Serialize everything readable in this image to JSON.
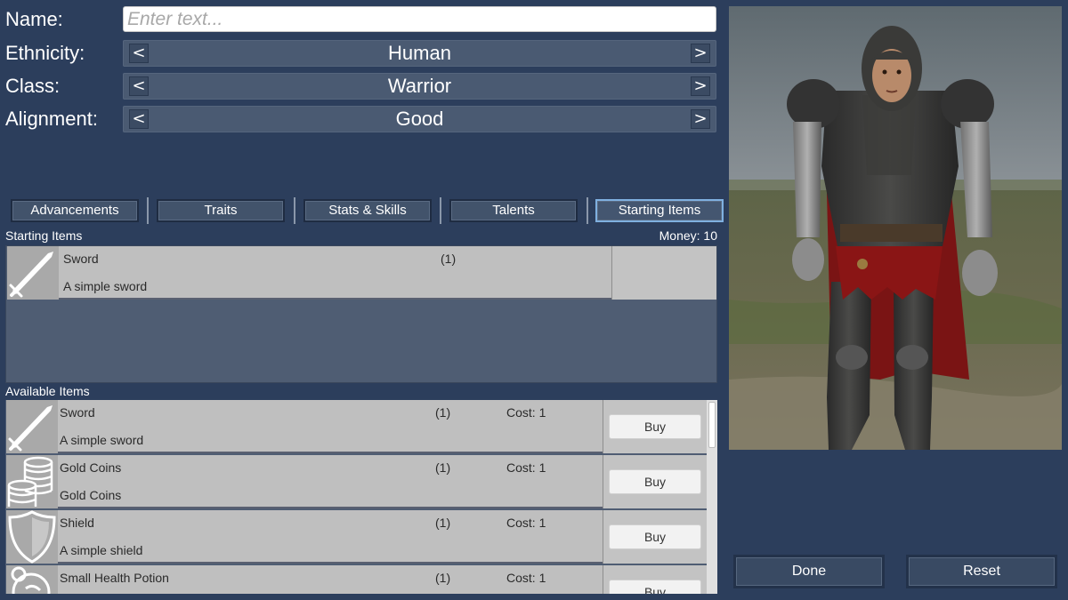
{
  "form": {
    "name": {
      "label": "Name:",
      "value": "",
      "placeholder": "Enter text..."
    },
    "ethnicity": {
      "label": "Ethnicity:",
      "value": "Human",
      "prev": "<",
      "next": ">"
    },
    "class": {
      "label": "Class:",
      "value": "Warrior",
      "prev": "<",
      "next": ">"
    },
    "alignment": {
      "label": "Alignment:",
      "value": "Good",
      "prev": "<",
      "next": ">"
    }
  },
  "tabs": [
    {
      "label": "Advancements",
      "active": false
    },
    {
      "label": "Traits",
      "active": false
    },
    {
      "label": "Stats & Skills",
      "active": false
    },
    {
      "label": "Talents",
      "active": false
    },
    {
      "label": "Starting Items",
      "active": true
    }
  ],
  "starting_items": {
    "title": "Starting Items",
    "money_label": "Money: 10",
    "items": [
      {
        "icon": "sword-icon",
        "name": "Sword",
        "qty": "(1)",
        "desc": "A simple sword"
      }
    ]
  },
  "available_items": {
    "title": "Available Items",
    "items": [
      {
        "icon": "sword-icon",
        "name": "Sword",
        "qty": "(1)",
        "cost": "Cost: 1",
        "desc": "A simple sword",
        "button": "Buy"
      },
      {
        "icon": "gold-coins-icon",
        "name": "Gold Coins",
        "qty": "(1)",
        "cost": "Cost: 1",
        "desc": "Gold Coins",
        "button": "Buy"
      },
      {
        "icon": "shield-icon",
        "name": "Shield",
        "qty": "(1)",
        "cost": "Cost: 1",
        "desc": "A simple shield",
        "button": "Buy"
      },
      {
        "icon": "potion-icon",
        "name": "Small Health Potion",
        "qty": "(1)",
        "cost": "Cost: 1",
        "desc": "",
        "button": "Buy"
      }
    ]
  },
  "buttons": {
    "done": "Done",
    "reset": "Reset"
  }
}
